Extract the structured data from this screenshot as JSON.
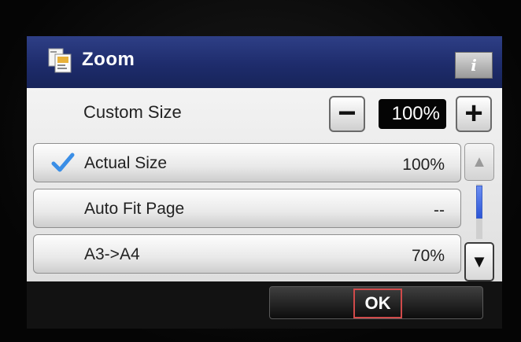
{
  "header": {
    "title": "Zoom",
    "title_icon": "zoom-copy-icon",
    "info_label": "i",
    "info_icon": "info-icon"
  },
  "custom_size": {
    "label": "Custom Size",
    "value": "100%",
    "minus_label": "−",
    "plus_label": "+"
  },
  "options": [
    {
      "label": "Actual Size",
      "value": "100%",
      "selected": true
    },
    {
      "label": "Auto Fit Page",
      "value": "--",
      "selected": false
    },
    {
      "label": "A3->A4",
      "value": "70%",
      "selected": false
    }
  ],
  "scrollbar": {
    "up_icon": "up-arrow-icon",
    "down_icon": "down-arrow-icon",
    "up_glyph": "▲",
    "down_glyph": "▼"
  },
  "footer": {
    "ok_label": "OK"
  },
  "colors": {
    "title_bar": "#1e2c6c",
    "check": "#3a8ee6",
    "ok_highlight": "#d04a4a"
  }
}
